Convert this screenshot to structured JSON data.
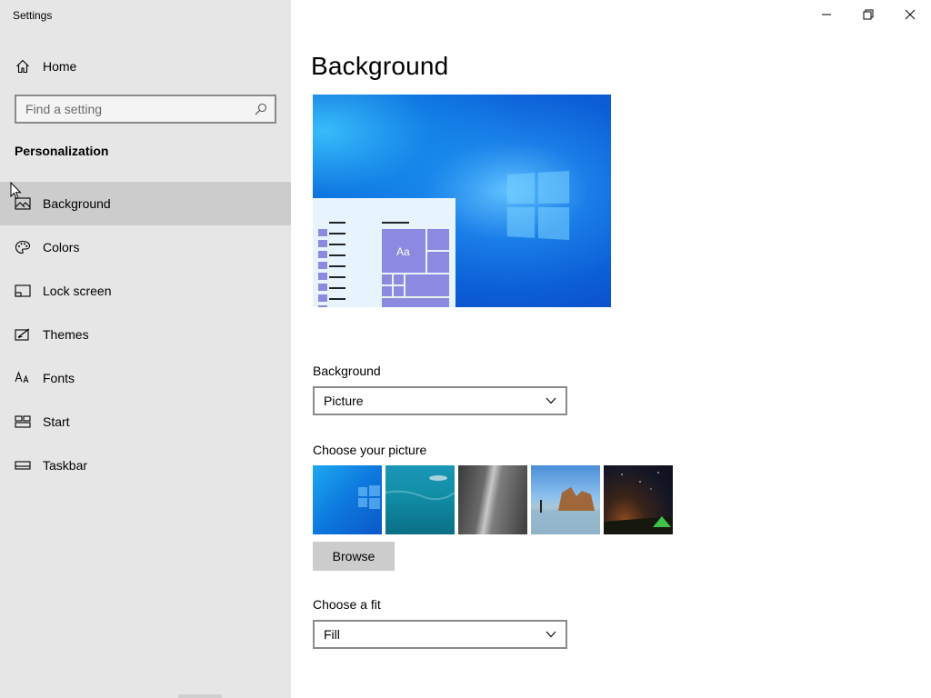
{
  "app": {
    "title": "Settings"
  },
  "sidebar": {
    "home_label": "Home",
    "search_placeholder": "Find a setting",
    "section_title": "Personalization",
    "items": [
      {
        "label": "Background",
        "icon": "picture-icon",
        "active": true
      },
      {
        "label": "Colors",
        "icon": "palette-icon",
        "active": false
      },
      {
        "label": "Lock screen",
        "icon": "lock-screen-icon",
        "active": false
      },
      {
        "label": "Themes",
        "icon": "themes-icon",
        "active": false
      },
      {
        "label": "Fonts",
        "icon": "fonts-icon",
        "active": false
      },
      {
        "label": "Start",
        "icon": "start-icon",
        "active": false
      },
      {
        "label": "Taskbar",
        "icon": "taskbar-icon",
        "active": false
      }
    ]
  },
  "main": {
    "page_title": "Background",
    "preview_tile_label": "Aa",
    "background_label": "Background",
    "background_value": "Picture",
    "choose_picture_label": "Choose your picture",
    "browse_label": "Browse",
    "choose_fit_label": "Choose a fit",
    "fit_value": "Fill"
  },
  "colors": {
    "sidebar_bg": "#e6e6e6",
    "active_item_bg": "#cccccc",
    "accent": "#8a88e0"
  }
}
